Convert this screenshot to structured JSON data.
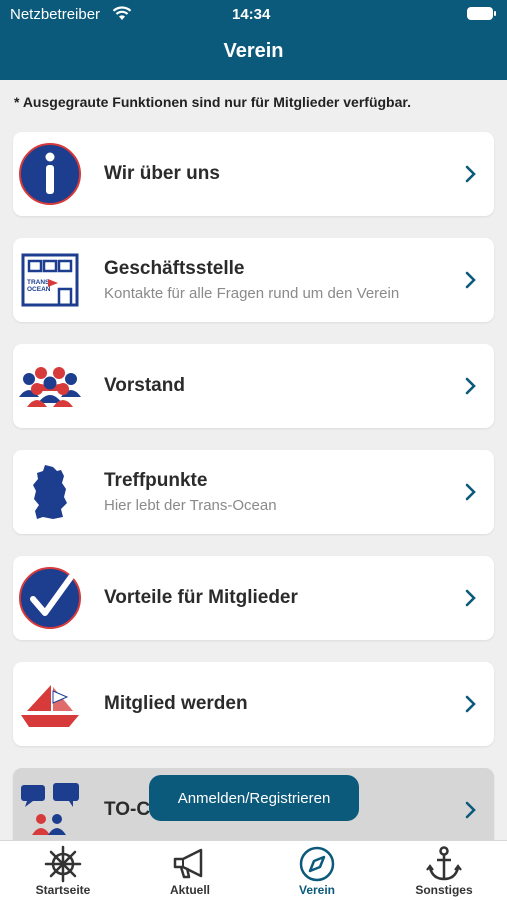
{
  "status": {
    "carrier": "Netzbetreiber",
    "time": "14:34"
  },
  "header": {
    "title": "Verein"
  },
  "notice": "* Ausgegraute Funktionen sind nur für Mitglieder verfügbar.",
  "items": [
    {
      "title": "Wir über uns",
      "subtitle": "",
      "icon": "info-icon",
      "enabled": true
    },
    {
      "title": "Geschäftsstelle",
      "subtitle": "Kontakte für alle Fragen rund um den Verein",
      "icon": "office-building-icon",
      "enabled": true
    },
    {
      "title": "Vorstand",
      "subtitle": "",
      "icon": "people-group-icon",
      "enabled": true
    },
    {
      "title": "Treffpunkte",
      "subtitle": "Hier lebt der Trans-Ocean",
      "icon": "germany-map-icon",
      "enabled": true
    },
    {
      "title": "Vorteile für Mitglieder",
      "subtitle": "",
      "icon": "checkmark-icon",
      "enabled": true
    },
    {
      "title": "Mitglied werden",
      "subtitle": "",
      "icon": "sailboat-icon",
      "enabled": true
    },
    {
      "title": "TO-C",
      "subtitle": "",
      "icon": "chat-people-icon",
      "enabled": false
    }
  ],
  "icon_texts": {
    "trans": "TRANS",
    "ocean": "OCEAN"
  },
  "toast": {
    "label": "Anmelden/Registrieren"
  },
  "tabs": [
    {
      "label": "Startseite",
      "icon": "helm-icon",
      "active": false
    },
    {
      "label": "Aktuell",
      "icon": "megaphone-icon",
      "active": false
    },
    {
      "label": "Verein",
      "icon": "compass-icon",
      "active": true
    },
    {
      "label": "Sonstiges",
      "icon": "anchor-icon",
      "active": false
    }
  ],
  "colors": {
    "primary": "#0b5a7c",
    "icon_navy": "#1d3d8f",
    "icon_red": "#d63a3a",
    "background": "#efefef",
    "disabled_card": "#d6d6d6"
  }
}
